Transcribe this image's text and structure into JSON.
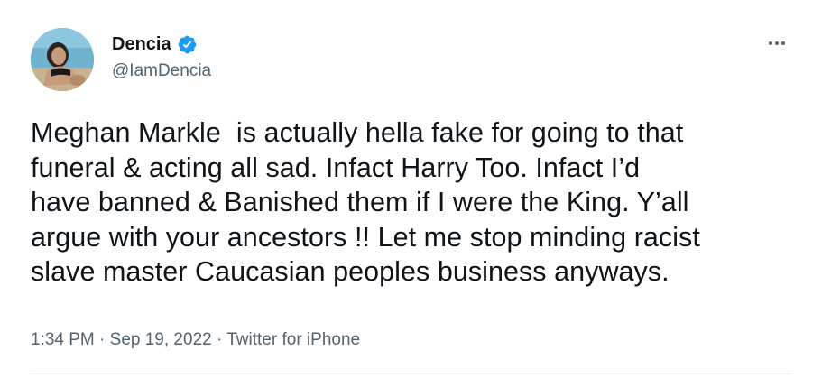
{
  "author": {
    "display_name": "Dencia",
    "handle": "@IamDencia",
    "verified": true
  },
  "tweet": {
    "text": "Meghan Markle  is actually hella fake for going to that funeral & acting all sad. Infact Harry Too. Infact I’d have banned & Banished them if I were the King. Y’all argue with your ancestors !! Let me stop minding racist slave master Caucasian peoples business anyways.",
    "lines": [
      "Meghan Markle  is actually hella fake for going to that",
      "funeral & acting all sad. Infact Harry Too. Infact I’d",
      "have banned & Banished them if I were the King. Y’all",
      "argue with your ancestors !! Let me stop minding racist",
      "slave master Caucasian peoples business anyways."
    ]
  },
  "meta": {
    "time": "1:34 PM",
    "separator": " · ",
    "date": "Sep 19, 2022",
    "source": "Twitter for iPhone"
  },
  "icons": {
    "verified": "verified-badge-icon",
    "more": "more-options-icon"
  },
  "colors": {
    "verified_blue": "#1d9bf0",
    "text_primary": "#0f1419",
    "text_secondary": "#536471",
    "divider": "#eff3f4"
  }
}
